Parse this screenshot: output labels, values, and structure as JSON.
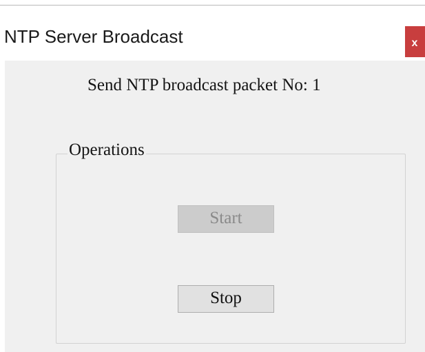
{
  "window": {
    "title": "NTP Server Broadcast",
    "close_glyph": "x"
  },
  "status": {
    "text": "Send NTP broadcast packet No: 1"
  },
  "operations": {
    "label": "Operations",
    "start_label": "Start",
    "start_enabled": false,
    "stop_label": "Stop",
    "stop_enabled": true
  },
  "colors": {
    "close_button": "#c83e3e",
    "client_background": "#f0f0f0",
    "disabled_button": "#cccccc",
    "button_face": "#e1e1e1"
  },
  "icons": {
    "close": "close-icon"
  }
}
